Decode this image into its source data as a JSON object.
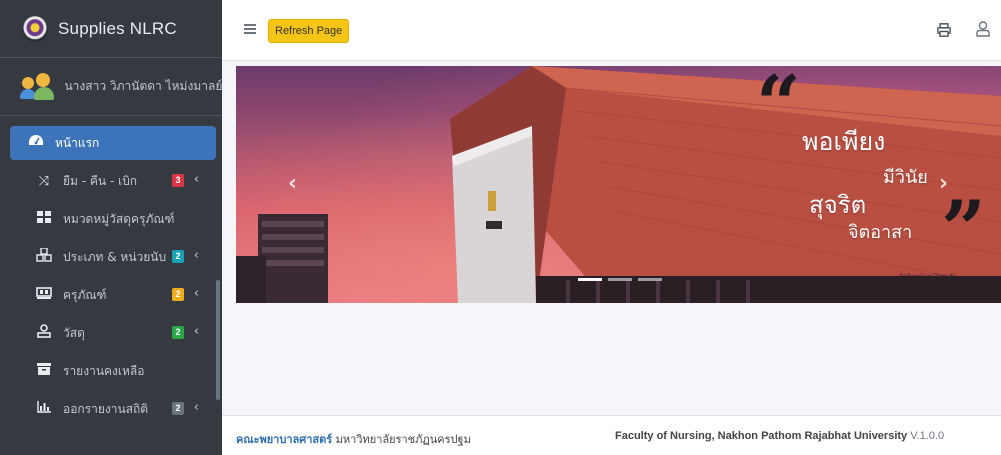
{
  "app": {
    "brand": "Supplies NLRC"
  },
  "user": {
    "name": "นางสาว วิภานัตดา ไหม่งมาลย์"
  },
  "sidebar": {
    "items": [
      {
        "label": "หน้าแรก",
        "icon": "dashboard-icon",
        "active": true
      },
      {
        "label": "ยืม - คืน - เบิก",
        "icon": "shuffle-icon",
        "badge": "3",
        "badge_color": "#dc3545"
      },
      {
        "label": "หมวดหมู่วัสดุครุภัณฑ์",
        "icon": "grid-icon"
      },
      {
        "label": "ประเภท & หน่วยนับ",
        "icon": "cubes-icon",
        "badge": "2",
        "badge_color": "#17a2b8"
      },
      {
        "label": "ครุภัณฑ์",
        "icon": "equipment-icon",
        "badge": "2",
        "badge_color": "#f0ad1c"
      },
      {
        "label": "วัสดุ",
        "icon": "user-box-icon",
        "badge": "2",
        "badge_color": "#28a745"
      },
      {
        "label": "รายงานคงเหลือ",
        "icon": "archive-icon"
      },
      {
        "label": "ออกรายงานสถิติ",
        "icon": "chart-icon",
        "badge": "2",
        "badge_color": "#6c757d"
      }
    ]
  },
  "topbar": {
    "refresh_label": "Refresh Page"
  },
  "banner": {
    "motto": [
      "พอเพียง",
      "มีวินัย",
      "สุจริต",
      "จิตอาสา"
    ],
    "credit": "อัตลักษณ์มหาวิทยาลัย"
  },
  "footer": {
    "faculty_th": "คณะพยาบาลศาสตร์",
    "university_th": " มหาวิทยาลัยราชภัฏนครปฐม",
    "faculty_en": "Faculty of Nursing, Nakhon Pathom Rajabhat University",
    "version": "V.1.0.0"
  },
  "colors": {
    "sidebar_bg": "#343a40",
    "active_item": "#3d73b8",
    "refresh_button": "#f5c516",
    "footer_link": "#2f6fb0"
  }
}
